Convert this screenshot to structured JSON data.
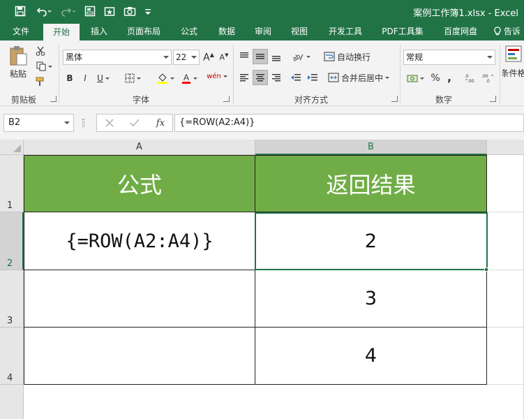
{
  "window": {
    "title": "案例工作簿1.xlsx - Excel"
  },
  "tabs": [
    {
      "label": "文件"
    },
    {
      "label": "开始"
    },
    {
      "label": "插入"
    },
    {
      "label": "页面布局"
    },
    {
      "label": "公式"
    },
    {
      "label": "数据"
    },
    {
      "label": "审阅"
    },
    {
      "label": "视图"
    },
    {
      "label": "开发工具"
    },
    {
      "label": "PDF工具集"
    },
    {
      "label": "百度网盘"
    },
    {
      "label": "告诉"
    }
  ],
  "active_tab": "开始",
  "ribbon": {
    "clipboard": {
      "paste_label": "粘贴",
      "group_label": "剪贴板"
    },
    "font": {
      "font_name": "黑体",
      "font_size": "22",
      "group_label": "字体",
      "bold": "B",
      "italic": "I",
      "underline": "U",
      "phonetic": "wén"
    },
    "alignment": {
      "wrap_text": "自动换行",
      "merge_center": "合并后居中",
      "group_label": "对齐方式"
    },
    "number": {
      "format": "常规",
      "percent": "%",
      "comma": ",",
      "group_label": "数字"
    },
    "styles": {
      "conditional_format": "条件格"
    }
  },
  "formula_bar": {
    "name_box": "B2",
    "formula": "{=ROW(A2:A4)}"
  },
  "sheet": {
    "columns": [
      "A",
      "B"
    ],
    "rows": [
      "1",
      "2",
      "3",
      "4"
    ],
    "header": {
      "a1": "公式",
      "b1": "返回结果"
    },
    "a2": "{=ROW(A2:A4)}",
    "results": [
      "2",
      "3",
      "4"
    ]
  },
  "colors": {
    "excel_green": "#217346",
    "header_fill": "#70ad47"
  }
}
